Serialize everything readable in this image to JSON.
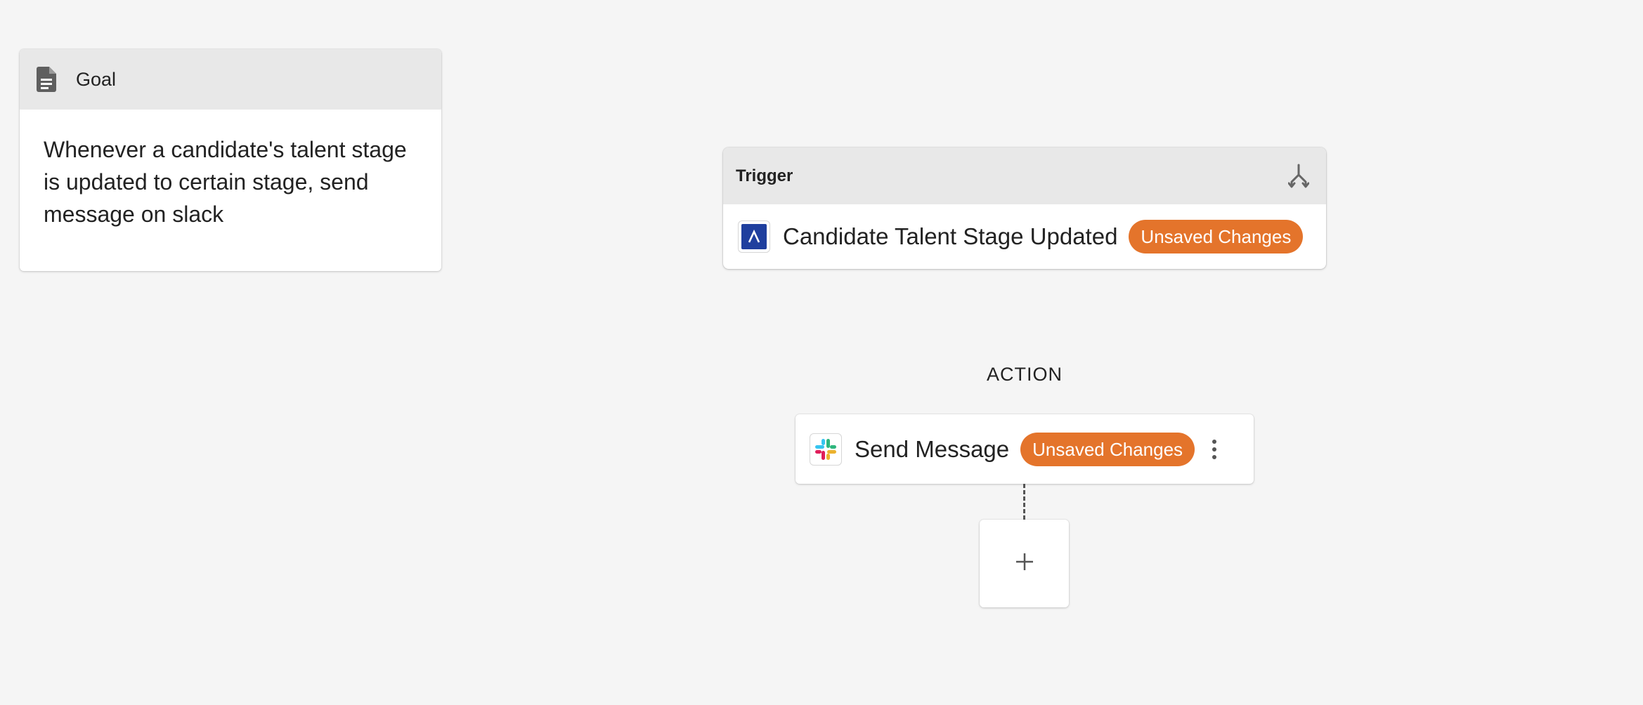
{
  "goal": {
    "title": "Goal",
    "icon": "document-icon",
    "description": "Whenever a candidate's talent stage is updated to certain stage, send message on slack"
  },
  "trigger": {
    "header": "Trigger",
    "header_icon": "branch-icon",
    "app_icon": "ashby-logo-icon",
    "name": "Candidate Talent Stage Updated",
    "badge": "Unsaved Changes"
  },
  "action_section": {
    "label": "ACTION"
  },
  "action": {
    "app_icon": "slack-logo-icon",
    "name": "Send Message",
    "badge": "Unsaved Changes",
    "menu_icon": "more-vertical-icon"
  },
  "add_step": {
    "icon": "plus-icon"
  },
  "colors": {
    "background": "#f5f5f5",
    "header_gray": "#e8e8e8",
    "badge_orange": "#e4742b",
    "ashby_blue": "#1f3f9e"
  }
}
